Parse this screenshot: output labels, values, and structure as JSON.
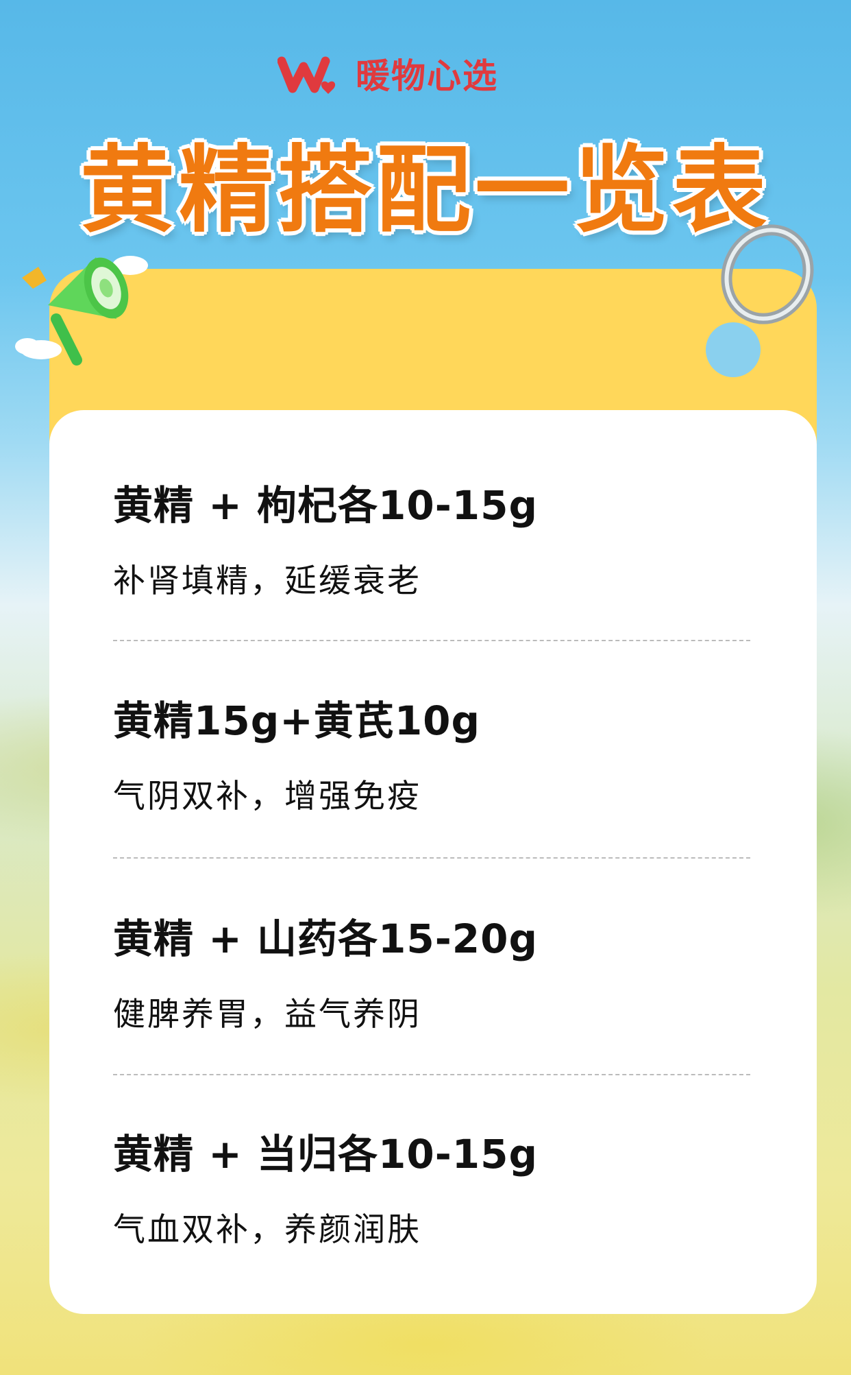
{
  "brand": {
    "name": "暖物心选"
  },
  "page": {
    "title": "黄精搭配一览表"
  },
  "combos": [
    {
      "title": "黄精 + 枸杞各10-15g",
      "desc": "补肾填精，延缓衰老"
    },
    {
      "title": "黄精15g+黄芪10g",
      "desc": "气阴双补，增强免疫"
    },
    {
      "title": "黄精 + 山药各15-20g",
      "desc": "健脾养胃，益气养阴"
    },
    {
      "title": "黄精 + 当归各10-15g",
      "desc": "气血双补，养颜润肤"
    }
  ],
  "colors": {
    "brand_red": "#e03a3e",
    "title_orange": "#f07a10",
    "card_yellow": "#ffd75a"
  },
  "icons": [
    "brand-logo-icon",
    "megaphone-icon",
    "bell-icon",
    "cloud-icon",
    "metal-ring-icon"
  ]
}
